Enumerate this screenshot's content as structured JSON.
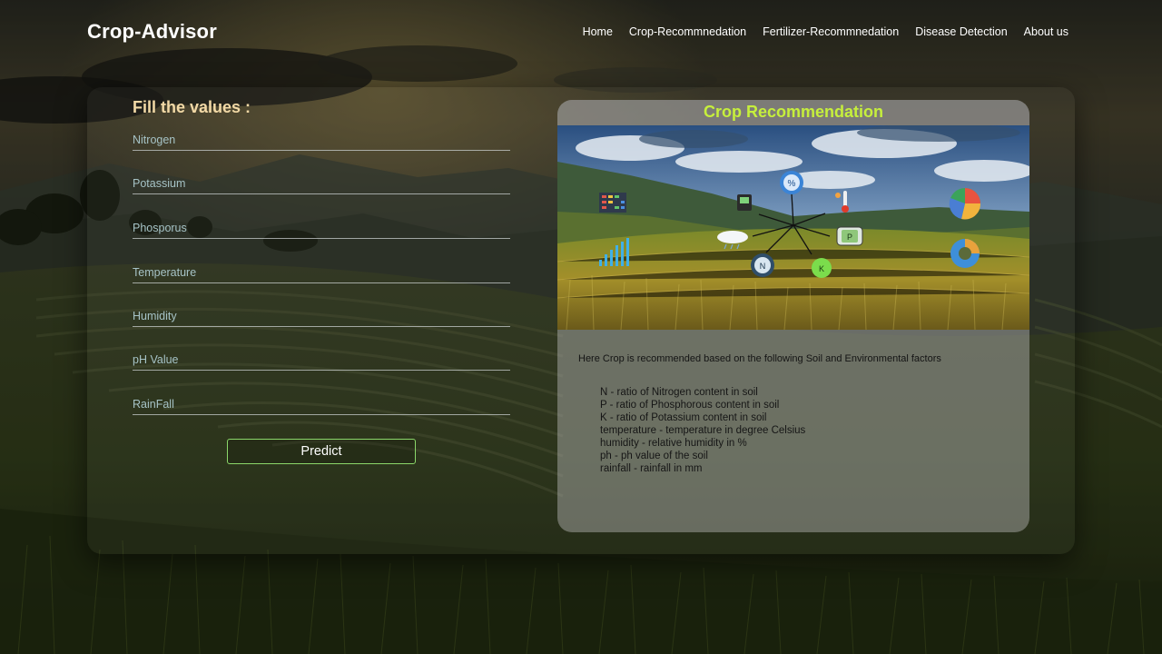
{
  "header": {
    "brand": "Crop-Advisor",
    "nav": [
      "Home",
      "Crop-Recommnedation",
      "Fertilizer-Recommnedation",
      "Disease Detection",
      "About us"
    ]
  },
  "form": {
    "title": "Fill the values :",
    "fields": [
      {
        "placeholder": "Nitrogen",
        "value": ""
      },
      {
        "placeholder": "Potassium",
        "value": ""
      },
      {
        "placeholder": "Phosporus",
        "value": ""
      },
      {
        "placeholder": "Temperature",
        "value": ""
      },
      {
        "placeholder": "Humidity",
        "value": ""
      },
      {
        "placeholder": "pH Value",
        "value": ""
      },
      {
        "placeholder": "RainFall",
        "value": ""
      }
    ],
    "submit_label": "Predict"
  },
  "info": {
    "title": "Crop Recommendation",
    "intro": "Here Crop is recommended based on the following Soil and Environmental factors",
    "factors": [
      "N - ratio of Nitrogen content in soil",
      "P - ratio of Phosphorous content in soil",
      "K - ratio of Potassium content in soil",
      "temperature - temperature in degree Celsius",
      "humidity - relative humidity in %",
      "ph - ph value of the soil",
      "rainfall - rainfall in mm"
    ],
    "image_icons": {
      "n": "N",
      "p": "P",
      "k": "K",
      "percent": "%"
    }
  },
  "colors": {
    "brand_text": "#ffffff",
    "form_title": "#f2d9a6",
    "card_title": "#c6ef3c",
    "button_border": "#8bd86a"
  }
}
